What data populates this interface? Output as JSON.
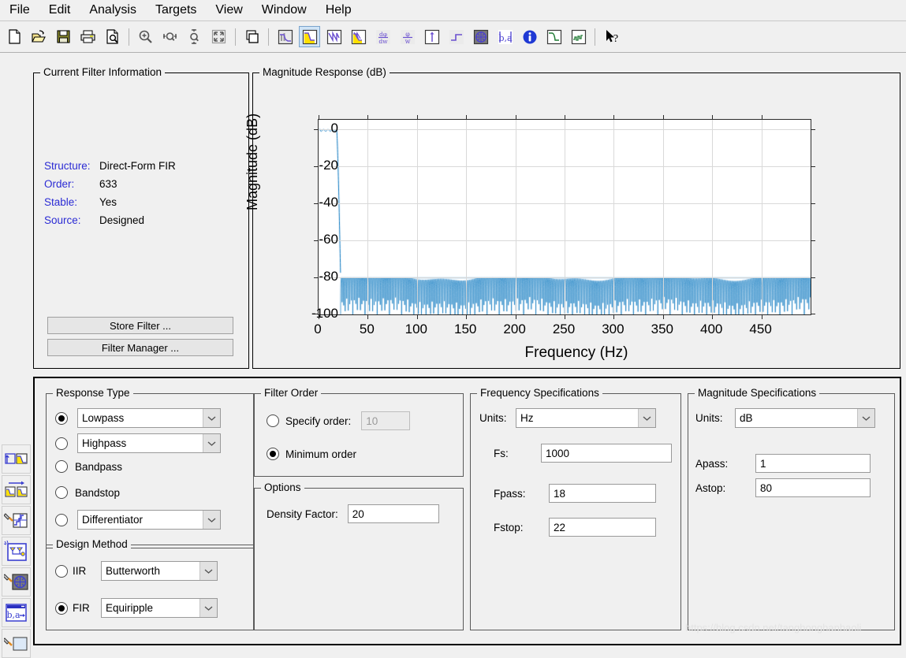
{
  "menu": {
    "items": [
      "File",
      "Edit",
      "Analysis",
      "Targets",
      "View",
      "Window",
      "Help"
    ]
  },
  "toolbar": {
    "buttons": [
      {
        "name": "new-filter",
        "icon": "new-document-icon",
        "active": false
      },
      {
        "name": "open-session",
        "icon": "open-folder-icon",
        "active": false
      },
      {
        "name": "save-session",
        "icon": "save-disk-icon",
        "active": false
      },
      {
        "name": "print",
        "icon": "printer-icon",
        "active": false
      },
      {
        "name": "print-preview",
        "icon": "print-preview-icon",
        "active": false
      },
      {
        "name": "zoom-in",
        "icon": "magnifier-plus-icon",
        "active": false
      },
      {
        "name": "zoom-x",
        "icon": "zoom-horizontal-icon",
        "active": false
      },
      {
        "name": "zoom-y",
        "icon": "zoom-vertical-icon",
        "active": false
      },
      {
        "name": "restore-default-view",
        "icon": "fullscreen-arrows-icon",
        "active": false
      },
      {
        "name": "full-view-analysis",
        "icon": "window-copy-icon",
        "active": false
      },
      {
        "name": "filter-specifications",
        "icon": "filter-spec-icon",
        "active": false
      },
      {
        "name": "magnitude-response",
        "icon": "magnitude-response-icon",
        "active": true
      },
      {
        "name": "phase-response",
        "icon": "phase-response-icon",
        "active": false
      },
      {
        "name": "magnitude-and-phase-response",
        "icon": "mag-phase-icon",
        "active": false
      },
      {
        "name": "group-delay-response",
        "icon": "group-delay-icon",
        "active": false
      },
      {
        "name": "phase-delay",
        "icon": "phase-delay-icon",
        "active": false
      },
      {
        "name": "impulse-response",
        "icon": "impulse-response-icon",
        "active": false
      },
      {
        "name": "step-response",
        "icon": "step-response-icon",
        "active": false
      },
      {
        "name": "pole-zero-plot",
        "icon": "pole-zero-icon",
        "active": false
      },
      {
        "name": "filter-coefficients",
        "icon": "coefficients-icon",
        "active": false
      },
      {
        "name": "filter-information",
        "icon": "info-circle-icon",
        "active": false
      },
      {
        "name": "magnitude-response-estimate",
        "icon": "mag-estimate-icon",
        "active": false
      },
      {
        "name": "round-off-noise-power",
        "icon": "noise-power-icon",
        "active": false
      },
      {
        "name": "context-help",
        "icon": "arrow-question-icon",
        "active": false
      }
    ]
  },
  "sidebar": {
    "buttons": [
      {
        "name": "design-filter",
        "icon": "design-filter-icon",
        "selected": false
      },
      {
        "name": "import-filter",
        "icon": "import-filter-icon",
        "selected": false
      },
      {
        "name": "quantize-filter",
        "icon": "quantize-filter-icon",
        "selected": false
      },
      {
        "name": "transform-filter",
        "icon": "transform-filter-icon",
        "selected": false
      },
      {
        "name": "multirate-filter",
        "icon": "multirate-filter-icon",
        "selected": false
      },
      {
        "name": "realize-model",
        "icon": "realize-model-icon",
        "selected": false
      },
      {
        "name": "set-quantization-parameters",
        "icon": "pencil-target-icon",
        "selected": false
      },
      {
        "name": "pole-zero-editor",
        "icon": "pole-zero-editor-icon",
        "selected": false
      }
    ]
  },
  "current_filter_information": {
    "title": "Current Filter Information",
    "rows": [
      {
        "key": "Structure:",
        "value": "Direct-Form FIR"
      },
      {
        "key": "Order:",
        "value": "633"
      },
      {
        "key": "Stable:",
        "value": "Yes"
      },
      {
        "key": "Source:",
        "value": "Designed"
      }
    ],
    "store_filter_label": "Store Filter ...",
    "filter_manager_label": "Filter Manager ..."
  },
  "plot_panel": {
    "title": "Magnitude Response (dB)"
  },
  "chart_data": {
    "type": "line",
    "title": "Magnitude Response (dB)",
    "xlabel": "Frequency (Hz)",
    "ylabel": "Magnitude (dB)",
    "xlim": [
      0,
      500
    ],
    "ylim": [
      -100,
      5
    ],
    "xticks": [
      0,
      50,
      100,
      150,
      200,
      250,
      300,
      350,
      400,
      450
    ],
    "yticks": [
      0,
      -20,
      -40,
      -60,
      -80,
      -100
    ],
    "grid": true,
    "legend": "none",
    "line_color": "#0072bd",
    "series": [
      {
        "name": "Magnitude response",
        "description": "Equiripple lowpass FIR, Fs=1000 Hz, Fpass=18 Hz, Fstop=22 Hz, Apass=1 dB, Astop=80 dB, order 633",
        "passband_range_hz": [
          0,
          18
        ],
        "passband_ripple_db": 1,
        "transition_range_hz": [
          18,
          22
        ],
        "stopband_range_hz": [
          22,
          500
        ],
        "stopband_attenuation_db": -80,
        "stopband_ripple_floor_db": -100
      }
    ]
  },
  "response_type": {
    "title": "Response Type",
    "options": [
      {
        "label": "Lowpass",
        "type": "combo",
        "selected": true
      },
      {
        "label": "Highpass",
        "type": "combo",
        "selected": false
      },
      {
        "label": "Bandpass",
        "type": "plain",
        "selected": false
      },
      {
        "label": "Bandstop",
        "type": "plain",
        "selected": false
      },
      {
        "label": "Differentiator",
        "type": "combo",
        "selected": false
      }
    ]
  },
  "design_method": {
    "title": "Design Method",
    "options": [
      {
        "label": "IIR",
        "value": "Butterworth",
        "selected": false
      },
      {
        "label": "FIR",
        "value": "Equiripple",
        "selected": true
      }
    ]
  },
  "filter_order": {
    "title": "Filter Order",
    "specify_order_label": "Specify order:",
    "specify_order_value": "10",
    "specify_order_selected": false,
    "minimum_order_label": "Minimum order",
    "minimum_order_selected": true
  },
  "options": {
    "title": "Options",
    "density_factor_label": "Density Factor:",
    "density_factor_value": "20"
  },
  "frequency_specifications": {
    "title": "Frequency Specifications",
    "units_label": "Units:",
    "units_value": "Hz",
    "fields": [
      {
        "label": "Fs:",
        "value": "1000"
      },
      {
        "label": "Fpass:",
        "value": "18"
      },
      {
        "label": "Fstop:",
        "value": "22"
      }
    ]
  },
  "magnitude_specifications": {
    "title": "Magnitude Specifications",
    "units_label": "Units:",
    "units_value": "dB",
    "fields": [
      {
        "label": "Apass:",
        "value": "1"
      },
      {
        "label": "Astop:",
        "value": "80"
      }
    ]
  },
  "watermark": {
    "text": "https://blog.csdn.net/tanghonghanhaoli"
  }
}
